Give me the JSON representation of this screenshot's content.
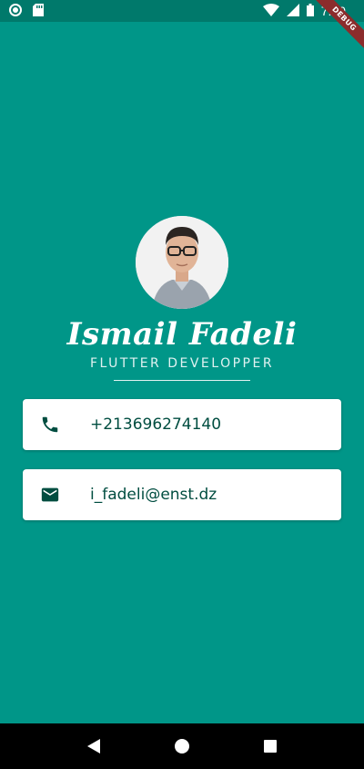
{
  "status_bar": {
    "time": "7:59",
    "icons": [
      "record-icon",
      "sd-card-icon",
      "wifi-icon",
      "signal-icon",
      "battery-icon"
    ]
  },
  "debug_banner": {
    "label": "DEBUG"
  },
  "profile": {
    "name": "Ismail Fadeli",
    "title": "FLUTTER DEVELOPPER"
  },
  "contacts": {
    "phone": {
      "icon": "phone-icon",
      "value": "+213696274140"
    },
    "email": {
      "icon": "mail-icon",
      "value": "i_fadeli@enst.dz"
    }
  },
  "nav_bar": {
    "buttons": [
      "back-triangle-icon",
      "home-circle-icon",
      "recents-square-icon"
    ]
  },
  "colors": {
    "background": "#009688",
    "status_bar": "#00796B",
    "icon_dark": "#004D40",
    "card": "#ffffff"
  }
}
